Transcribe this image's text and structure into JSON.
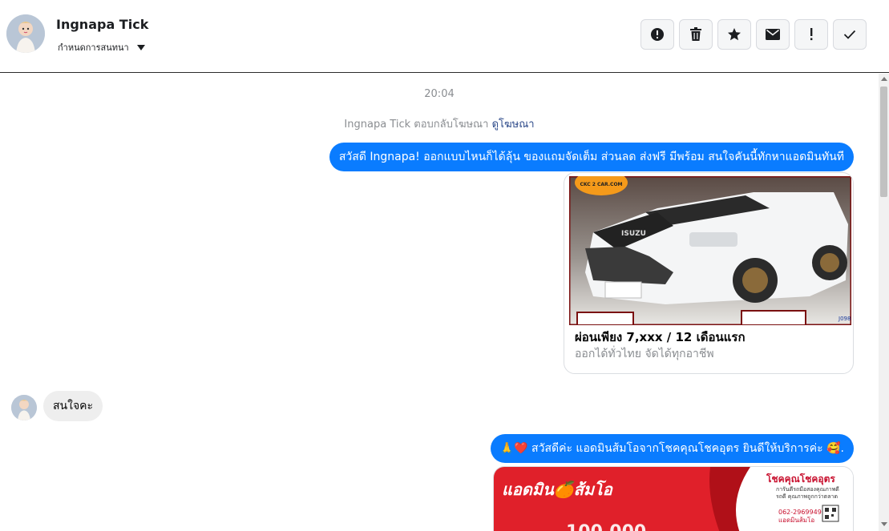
{
  "header": {
    "contact_name": "Ingnapa Tick",
    "assign_label": "กำหนดการสนทนา",
    "actions": [
      "alert-circle-icon",
      "trash-icon",
      "star-icon",
      "envelope-icon",
      "exclamation-icon",
      "check-icon"
    ]
  },
  "chat": {
    "timestamp": "20:04",
    "notice_text": "Ingnapa Tick ตอบกลับโฆษณา",
    "notice_link": "ดูโฆษณา",
    "messages": [
      {
        "direction": "outgoing",
        "text": "สวัสดี Ingnapa! ออกแบบไหนก็ได้ลุ้น ของแถมจัดเต็ม ส่วนลด ส่งฟรี มีพร้อม สนใจคันนี้ทักหาแอดมินทันที"
      },
      {
        "direction": "outgoing",
        "type": "ad-card",
        "image": "white-pickup-truck",
        "watermark": "CKC 2 CAR.COM",
        "title": "ผ่อนเพียง 7,xxx / 12 เดือนแรก",
        "subtitle": "ออกได้ทั่วไทย จัดได้ทุกอาชีพ"
      },
      {
        "direction": "incoming",
        "text": "สนใจคะ"
      },
      {
        "direction": "outgoing",
        "text": "🙏❤️ สวัสดีค่ะ แอดมินส้มโอจากโชคคุณโชคอุตร ยินดีให้บริการค่ะ 🥰."
      },
      {
        "direction": "outgoing",
        "type": "image-card",
        "logo_text": "แอดมิน🍊ส้มโอ",
        "brand": "โชคคุณโชคอุตร",
        "tagline": "การันตีรถมือสองคุณภาพดี\nรถดี คุณภาพถูกกว่าตลาด",
        "phone": "062-2969949\nแอดมินส้มโอ"
      }
    ]
  },
  "colors": {
    "outgoing_bubble": "#0a7cff",
    "incoming_bubble": "#eeeeee",
    "link": "#2d4a8a",
    "muted_text": "#8a8d91"
  }
}
